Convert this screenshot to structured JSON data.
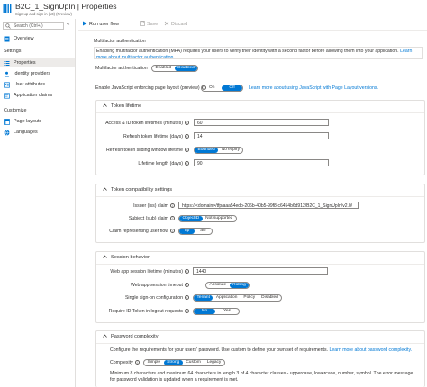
{
  "header": {
    "title": "B2C_1_SignUpIn | Properties",
    "subtitle": "Sign up and sign in (v3) (Preview)"
  },
  "sidebar": {
    "search_placeholder": "Search (Ctrl+/)",
    "collapse_glyph": "«",
    "overview": "Overview",
    "settings_heading": "Settings",
    "items": [
      "Properties",
      "Identity providers",
      "User attributes",
      "Application claims"
    ],
    "customize_heading": "Customize",
    "customize_items": [
      "Page layouts",
      "Languages"
    ]
  },
  "toolbar": {
    "run": "Run user flow",
    "save": "Save",
    "discard": "Discard"
  },
  "mfa": {
    "heading": "Multifactor authentication",
    "notice_text": "Enabling multifactor authentication (MFA) requires your users to verify their identity with a second factor before allowing them into your application.",
    "notice_link": "Learn more about multifactor authentication",
    "label": "Multifactor authentication",
    "options": [
      "Enabled",
      "Disabled"
    ],
    "selected": "Disabled"
  },
  "js": {
    "label": "Enable JavaScript enforcing page layout (preview)",
    "options": [
      "On",
      "Off"
    ],
    "selected": "Off",
    "link": "Learn more about using JavaScript with Page Layout versions."
  },
  "token_lifetime": {
    "title": "Token lifetime",
    "rows": [
      {
        "label": "Access & ID token lifetimes (minutes)",
        "value": "60"
      },
      {
        "label": "Refresh token lifetime (days)",
        "value": "14"
      },
      {
        "label": "Refresh token sliding window lifetime",
        "options": [
          "Bounded",
          "No expiry"
        ],
        "selected": "Bounded"
      },
      {
        "label": "Lifetime length (days)",
        "value": "90"
      }
    ]
  },
  "token_compat": {
    "title": "Token compatibility settings",
    "issuer_label": "Issuer (iss) claim",
    "issuer_value": "https://<domain>/tfp/aaa54edb-206b-40b5-99f8-c6454b6d912/B2C_1_SignUpIn/v2.0/",
    "subject_label": "Subject (sub) claim",
    "subject_options": [
      "ObjectID",
      "Not supported"
    ],
    "subject_selected": "ObjectID",
    "claim_label": "Claim representing user flow",
    "claim_options": [
      "tfp",
      "acr"
    ],
    "claim_selected": "tfp"
  },
  "session": {
    "title": "Session behavior",
    "web_lifetime_label": "Web app session lifetime (minutes)",
    "web_lifetime_value": "1440",
    "timeout_label": "Web app session timeout",
    "timeout_options": [
      "Absolute",
      "Rolling"
    ],
    "timeout_selected": "Rolling",
    "sso_label": "Single sign-on configuration",
    "sso_options": [
      "Tenant",
      "Application",
      "Policy",
      "Disabled"
    ],
    "sso_selected": "Tenant",
    "logout_label": "Require ID Token in logout requests",
    "logout_options": [
      "No",
      "Yes"
    ],
    "logout_selected": "No"
  },
  "password": {
    "title": "Password complexity",
    "desc": "Configure the requirements for your users' password. Use custom to define your own set of requirements.",
    "desc_link": "Learn more about password complexity.",
    "label": "Complexity",
    "options": [
      "Simple",
      "Strong",
      "Custom",
      "Legacy"
    ],
    "selected": "Strong",
    "note": "Minimum 8 characters and maximum 64 characters in length 3 of 4 character classes - uppercase, lowercase, number, symbol. The error message for password validation is updated when a requirement is met."
  },
  "colors": {
    "accent": "#0078d4",
    "selected_nav": "#edebe9",
    "border": "#8a8886"
  }
}
